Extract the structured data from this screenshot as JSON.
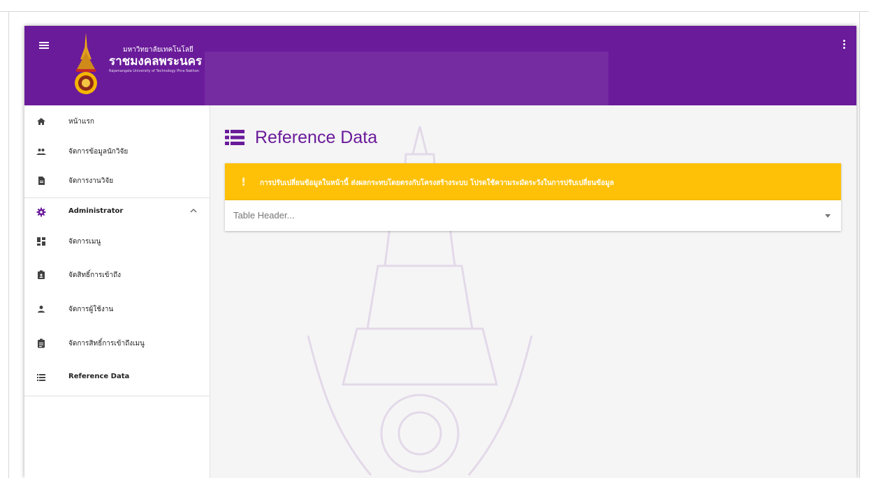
{
  "app": {
    "brand_line1": "มหาวิทยาลัยเทคโนโลยี",
    "brand_line2": "ราชมงคลพระนคร",
    "brand_line3": "Rajamangala University of Technology Phra Nakhon",
    "menu_icon": "hamburger-icon",
    "more_icon": "more-vert-icon",
    "brand_color": "#6a1b9a"
  },
  "sidebar": {
    "items": [
      {
        "label": "หน้าแรก",
        "icon": "home-icon"
      },
      {
        "label": "จัดการข้อมูลนักวิจัย",
        "icon": "people-icon"
      },
      {
        "label": "จัดการงานวิจัย",
        "icon": "document-icon"
      },
      {
        "label": "Administrator",
        "icon": "gear-icon",
        "expanded": true
      },
      {
        "label": "จัดการเมนู",
        "icon": "dashboard-icon"
      },
      {
        "label": "จัดสิทธิ์การเข้าถึง",
        "icon": "badge-icon"
      },
      {
        "label": "จัดการผู้ใช้งาน",
        "icon": "person-icon"
      },
      {
        "label": "จัดการสิทธิ์การเข้าถึงเมนู",
        "icon": "clipboard-icon"
      },
      {
        "label": "Reference Data",
        "icon": "list-icon"
      }
    ]
  },
  "main": {
    "title": "Reference Data",
    "title_icon": "list-icon",
    "alert": {
      "symbol": "!",
      "text": "การปรับเปลี่ยนข้อมูลในหน้านี้ ส่งผลกระทบโดยตรงกับโครงสร้างระบบ โปรดใช้ความระมัดระวังในการปรับเปลี่ยนข้อมูล",
      "color": "#ffc107"
    },
    "select": {
      "placeholder": "Table Header..."
    }
  }
}
